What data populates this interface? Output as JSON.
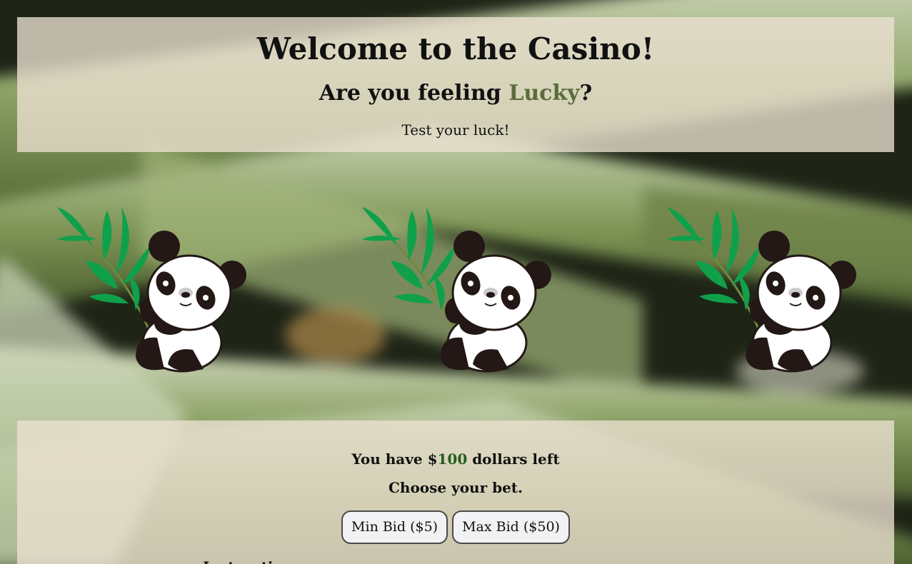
{
  "header": {
    "title": "Welcome to the Casino!",
    "subtitle_prefix": "Are you feeling ",
    "subtitle_highlight": "Lucky",
    "subtitle_suffix": "?",
    "tagline": "Test your luck!"
  },
  "slots": [
    {
      "symbol": "panda-with-bamboo"
    },
    {
      "symbol": "panda-with-bamboo"
    },
    {
      "symbol": "panda-with-bamboo"
    }
  ],
  "status": {
    "money_prefix": "You have $",
    "money_amount": "100",
    "money_suffix": " dollars left",
    "choose_bet": "Choose your bet."
  },
  "bids": {
    "min_label": "Min Bid ($5)",
    "max_label": "Max Bid ($50)"
  },
  "instructions": {
    "heading": "Instructions"
  },
  "colors": {
    "panel": "#ece2d2",
    "lucky": "#5b6c3b",
    "money": "#245d1f",
    "bamboo_leaf": "#0fa04a"
  }
}
